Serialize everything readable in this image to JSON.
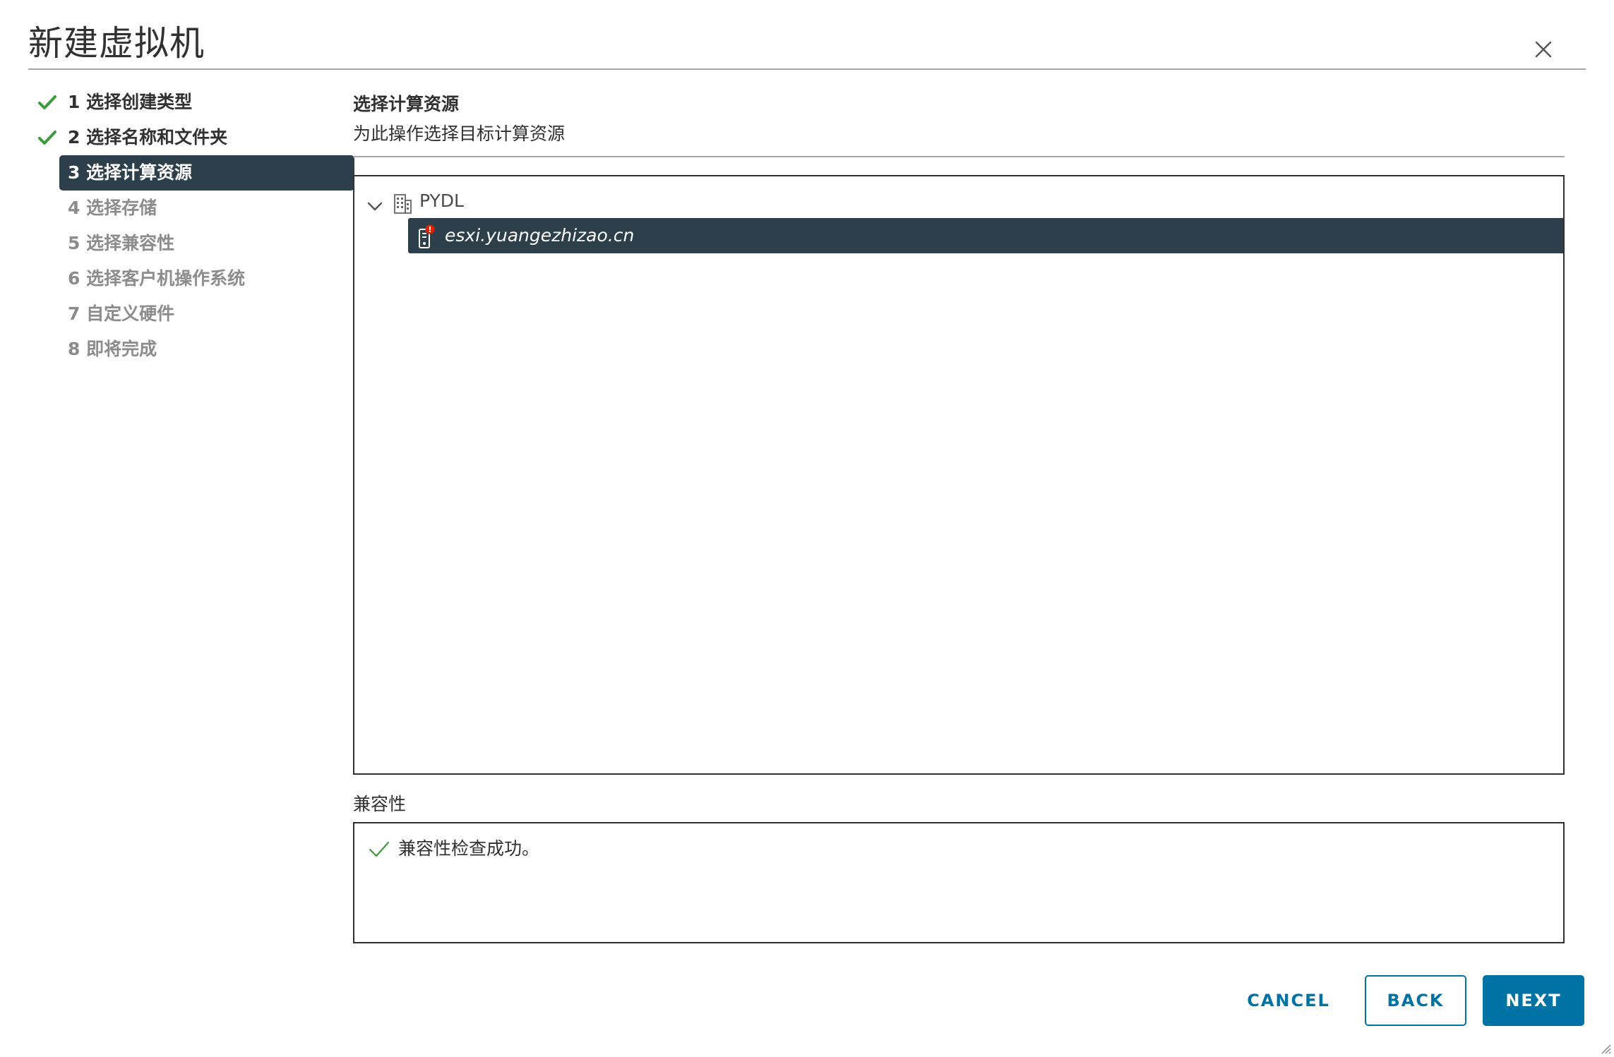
{
  "dialog": {
    "title": "新建虚拟机",
    "close_icon": "close-icon"
  },
  "steps": [
    {
      "label": "1 选择创建类型",
      "state": "done"
    },
    {
      "label": "2 选择名称和文件夹",
      "state": "done"
    },
    {
      "label": "3 选择计算资源",
      "state": "current"
    },
    {
      "label": "4 选择存储",
      "state": "pending"
    },
    {
      "label": "5 选择兼容性",
      "state": "pending"
    },
    {
      "label": "6 选择客户机操作系统",
      "state": "pending"
    },
    {
      "label": "7 自定义硬件",
      "state": "pending"
    },
    {
      "label": "8 即将完成",
      "state": "pending"
    }
  ],
  "main": {
    "title": "选择计算资源",
    "subtitle": "为此操作选择目标计算资源",
    "tree": {
      "root": {
        "label": "PYDL",
        "icon": "datacenter-icon",
        "expanded": true
      },
      "children": [
        {
          "label": "esxi.yuangezhizao.cn",
          "icon": "host-warning-icon",
          "selected": true
        }
      ]
    },
    "compatibility": {
      "title": "兼容性",
      "message": "兼容性检查成功。",
      "icon": "check-icon"
    }
  },
  "footer": {
    "cancel_label": "CANCEL",
    "back_label": "BACK",
    "next_label": "NEXT"
  },
  "colors": {
    "accent": "#0072a3",
    "selected_bg": "#2d3f4b",
    "success": "#3c9b3c",
    "warning": "#e12200"
  }
}
